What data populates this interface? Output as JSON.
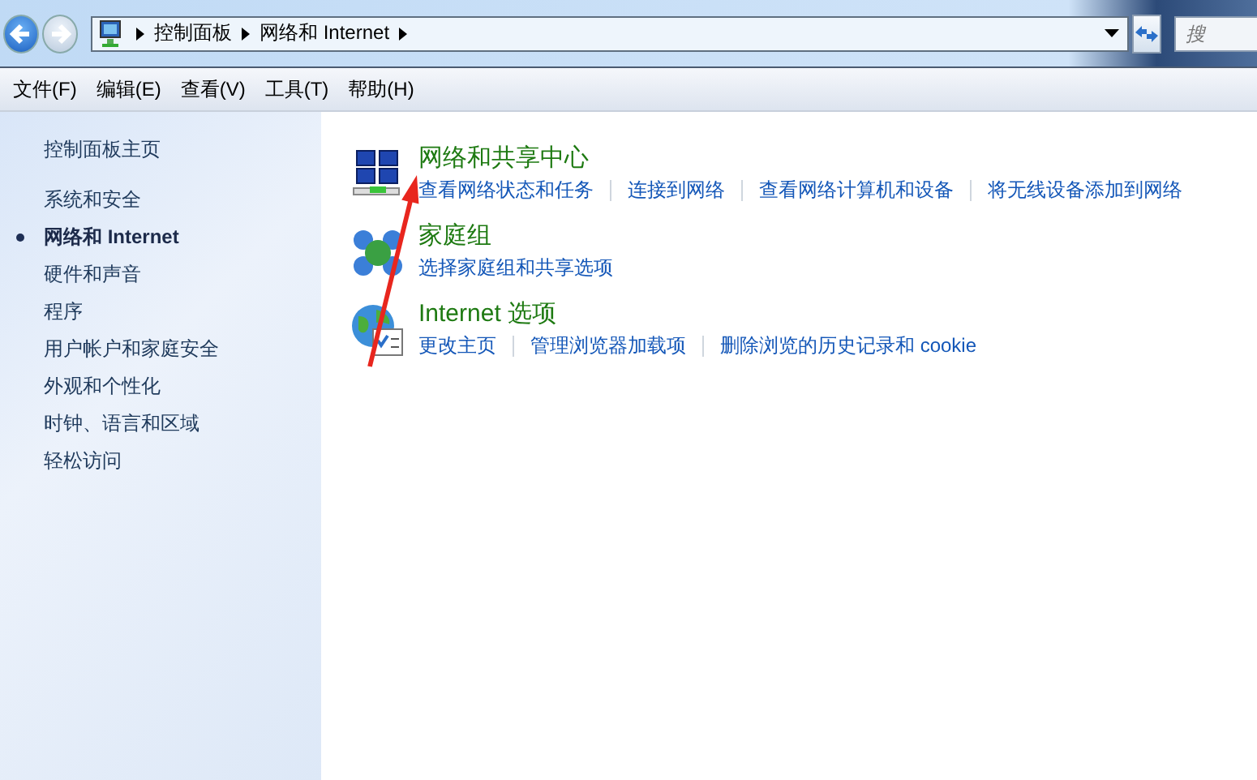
{
  "address_bar": {
    "crumbs": [
      "控制面板",
      "网络和 Internet"
    ]
  },
  "search": {
    "placeholder": "搜"
  },
  "menu": [
    "文件(F)",
    "编辑(E)",
    "查看(V)",
    "工具(T)",
    "帮助(H)"
  ],
  "sidebar": {
    "home": "控制面板主页",
    "items": [
      {
        "label": "系统和安全",
        "selected": false
      },
      {
        "label": "网络和 Internet",
        "selected": true
      },
      {
        "label": "硬件和声音",
        "selected": false
      },
      {
        "label": "程序",
        "selected": false
      },
      {
        "label": "用户帐户和家庭安全",
        "selected": false
      },
      {
        "label": "外观和个性化",
        "selected": false
      },
      {
        "label": "时钟、语言和区域",
        "selected": false
      },
      {
        "label": "轻松访问",
        "selected": false
      }
    ]
  },
  "sections": [
    {
      "title": "网络和共享中心",
      "links": [
        "查看网络状态和任务",
        "连接到网络",
        "查看网络计算机和设备",
        "将无线设备添加到网络"
      ]
    },
    {
      "title": "家庭组",
      "links": [
        "选择家庭组和共享选项"
      ]
    },
    {
      "title": "Internet 选项",
      "links": [
        "更改主页",
        "管理浏览器加载项",
        "删除浏览的历史记录和 cookie"
      ]
    }
  ]
}
